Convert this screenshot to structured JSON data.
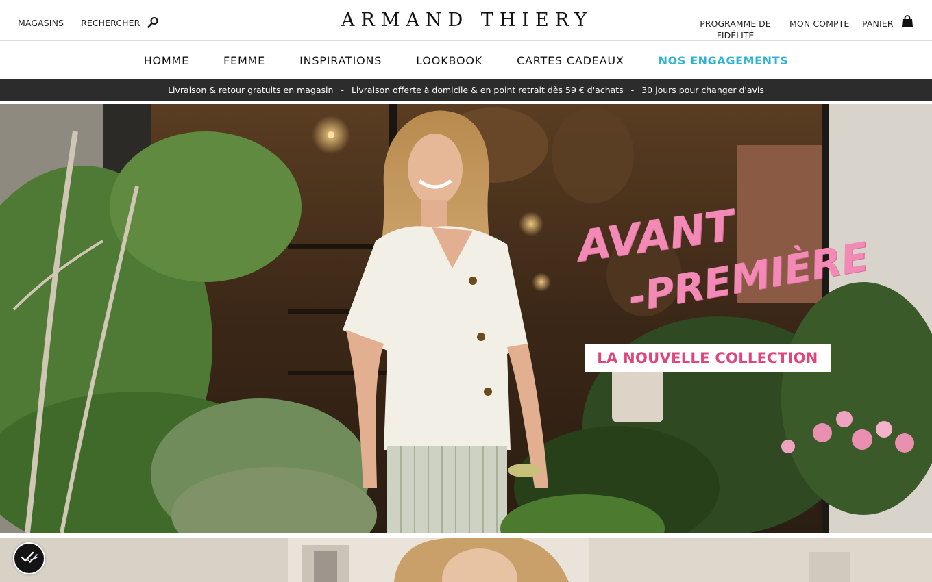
{
  "header": {
    "stores_label": "MAGASINS",
    "search_label": "RECHERCHER",
    "logo": "ARMAND THIERY",
    "loyalty_line1": "PROGRAMME DE",
    "loyalty_line2": "FIDÉLITÉ",
    "account_label": "MON COMPTE",
    "cart_label": "PANIER"
  },
  "nav": {
    "items": [
      "HOMME",
      "FEMME",
      "INSPIRATIONS",
      "LOOKBOOK",
      "CARTES CADEAUX",
      "NOS ENGAGEMENTS"
    ],
    "accent_color": "#2fb4d4"
  },
  "promo": {
    "items": [
      "Livraison & retour gratuits en magasin",
      "Livraison offerte à domicile & en point retrait dès 59 € d'achats",
      "30 jours pour changer d'avis"
    ],
    "separator": "-"
  },
  "hero": {
    "title_line1": "AVANT",
    "title_line2": "-PREMIÈRE",
    "cta_label": "LA NOUVELLE COLLECTION",
    "title_color": "#f28ab5",
    "cta_color": "#e0457c"
  },
  "icons": {
    "search": "search-icon",
    "cart": "shopping-bag-icon",
    "consent": "cookie-consent-icon"
  }
}
